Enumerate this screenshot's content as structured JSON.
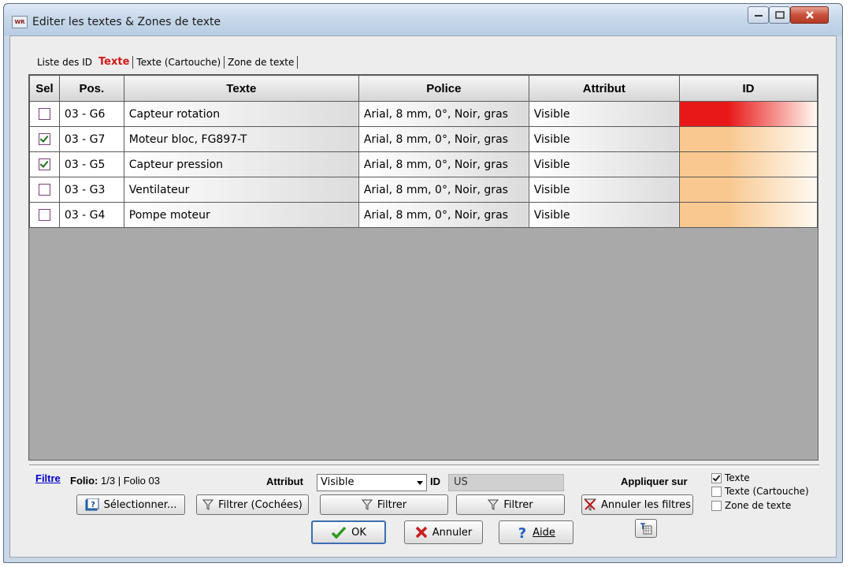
{
  "window": {
    "title": "Editer les textes & Zones de texte",
    "app_icon": "app-logo",
    "app_icon_text": "WR"
  },
  "tabs": [
    {
      "label": "Liste des ID",
      "active": false
    },
    {
      "label": "Texte",
      "active": true
    },
    {
      "label": "Texte (Cartouche)",
      "active": false
    },
    {
      "label": "Zone de texte",
      "active": false
    }
  ],
  "table": {
    "headers": [
      "Sel",
      "Pos.",
      "Texte",
      "Police",
      "Attribut",
      "ID"
    ],
    "rows": [
      {
        "checked": false,
        "pos": "03 - G6",
        "texte": "Capteur rotation",
        "police": "Arial, 8 mm, 0°, Noir, gras",
        "attribut": "Visible",
        "id_color": "#e81818"
      },
      {
        "checked": true,
        "pos": "03 - G7",
        "texte": "Moteur bloc, FG897-T",
        "police": "Arial, 8 mm, 0°, Noir, gras",
        "attribut": "Visible",
        "id_color": "#f8c890"
      },
      {
        "checked": true,
        "pos": "03 - G5",
        "texte": "Capteur pression",
        "police": "Arial, 8 mm, 0°, Noir, gras",
        "attribut": "Visible",
        "id_color": "#f8c890"
      },
      {
        "checked": false,
        "pos": "03 - G3",
        "texte": "Ventilateur",
        "police": "Arial, 8 mm, 0°, Noir, gras",
        "attribut": "Visible",
        "id_color": "#f8c890"
      },
      {
        "checked": false,
        "pos": "03 - G4",
        "texte": "Pompe moteur",
        "police": "Arial, 8 mm, 0°, Noir, gras",
        "attribut": "Visible",
        "id_color": "#f8c890"
      }
    ]
  },
  "filter": {
    "link": "Filtre",
    "folio_label": "Folio:",
    "folio_value": "1/3",
    "folio_sep": "|",
    "folio_name": "Folio 03",
    "attribut_label": "Attribut",
    "attribut_value": "Visible",
    "id_label": "ID",
    "id_value": "US",
    "appliquer_label": "Appliquer sur",
    "options": [
      {
        "label": "Texte",
        "checked": true
      },
      {
        "label": "Texte (Cartouche)",
        "checked": false
      },
      {
        "label": "Zone de texte",
        "checked": false
      }
    ]
  },
  "buttons": {
    "selectionner": "Sélectionner...",
    "filtrer_cochees": "Filtrer (Cochées)",
    "filtrer1": "Filtrer",
    "filtrer2": "Filtrer",
    "annuler_filtres": "Annuler les filtres",
    "ok": "OK",
    "annuler": "Annuler",
    "aide": "Aide"
  },
  "colors": {
    "accent_tab": "#d01818",
    "link": "#0000cc",
    "ok_border": "#3b6fb0"
  }
}
